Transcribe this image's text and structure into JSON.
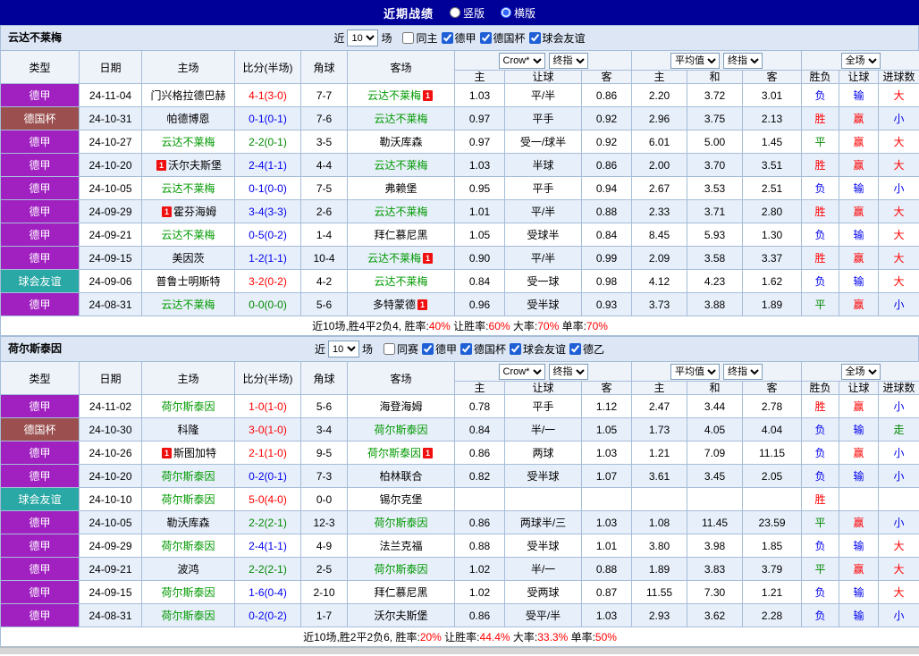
{
  "topbar": {
    "title": "近期战绩",
    "options": [
      {
        "label": "竖版",
        "selected": false
      },
      {
        "label": "横版",
        "selected": true
      }
    ]
  },
  "table_headers": {
    "main": [
      "类型",
      "日期",
      "主场",
      "比分(半场)",
      "角球",
      "客场"
    ],
    "odds_selects": [
      "Crow*",
      "终指"
    ],
    "avg_selects": [
      "平均值",
      "终指"
    ],
    "full_selects": [
      "全场"
    ],
    "sub": [
      "主",
      "让球",
      "客",
      "主",
      "和",
      "客",
      "胜负",
      "让球",
      "进球数"
    ]
  },
  "palette": {
    "red": "#ff0000",
    "green": "#008800",
    "blue": "#0000ee",
    "team_green": "#009900",
    "black": "#000000",
    "topbar_bg": "#000099",
    "league_colors": {
      "德甲": "#a020c0",
      "德国杯": "#9b4f4f",
      "球会友谊": "#2aa8a5"
    }
  },
  "sections": [
    {
      "team": "云达不莱梅",
      "filter": {
        "prefix": "近",
        "count": "10",
        "suffix": "场",
        "checkboxes": [
          {
            "label": "同主",
            "checked": false
          },
          {
            "label": "德甲",
            "checked": true
          },
          {
            "label": "德国杯",
            "checked": true
          },
          {
            "label": "球会友谊",
            "checked": true
          }
        ]
      },
      "rows": [
        {
          "league": "德甲",
          "date": "24-11-04",
          "home": {
            "name": "门兴格拉德巴赫"
          },
          "score": {
            "text": "4-1(3-0)",
            "color": "red"
          },
          "corner": "7-7",
          "away": {
            "name": "云达不莱梅",
            "self": true,
            "badge_after": "1"
          },
          "odds": [
            "1.03",
            "平/半",
            "0.86"
          ],
          "avg": [
            "2.20",
            "3.72",
            "3.01"
          ],
          "result": [
            [
              "负",
              "blue"
            ],
            [
              "输",
              "blue"
            ],
            [
              "大",
              "red"
            ]
          ]
        },
        {
          "league": "德国杯",
          "date": "24-10-31",
          "home": {
            "name": "帕德博恩"
          },
          "score": {
            "text": "0-1(0-1)",
            "color": "blue"
          },
          "corner": "7-6",
          "away": {
            "name": "云达不莱梅",
            "self": true
          },
          "odds": [
            "0.97",
            "平手",
            "0.92"
          ],
          "avg": [
            "2.96",
            "3.75",
            "2.13"
          ],
          "result": [
            [
              "胜",
              "red"
            ],
            [
              "赢",
              "red"
            ],
            [
              "小",
              "blue"
            ]
          ]
        },
        {
          "league": "德甲",
          "date": "24-10-27",
          "home": {
            "name": "云达不莱梅",
            "self": true
          },
          "score": {
            "text": "2-2(0-1)",
            "color": "green"
          },
          "corner": "3-5",
          "away": {
            "name": "勒沃库森"
          },
          "odds": [
            "0.97",
            "受一/球半",
            "0.92"
          ],
          "avg": [
            "6.01",
            "5.00",
            "1.45"
          ],
          "result": [
            [
              "平",
              "green"
            ],
            [
              "赢",
              "red"
            ],
            [
              "大",
              "red"
            ]
          ]
        },
        {
          "league": "德甲",
          "date": "24-10-20",
          "home": {
            "name": "沃尔夫斯堡",
            "badge_before": "1"
          },
          "score": {
            "text": "2-4(1-1)",
            "color": "blue"
          },
          "corner": "4-4",
          "away": {
            "name": "云达不莱梅",
            "self": true
          },
          "odds": [
            "1.03",
            "半球",
            "0.86"
          ],
          "avg": [
            "2.00",
            "3.70",
            "3.51"
          ],
          "result": [
            [
              "胜",
              "red"
            ],
            [
              "赢",
              "red"
            ],
            [
              "大",
              "red"
            ]
          ]
        },
        {
          "league": "德甲",
          "date": "24-10-05",
          "home": {
            "name": "云达不莱梅",
            "self": true
          },
          "score": {
            "text": "0-1(0-0)",
            "color": "blue"
          },
          "corner": "7-5",
          "away": {
            "name": "弗赖堡"
          },
          "odds": [
            "0.95",
            "平手",
            "0.94"
          ],
          "avg": [
            "2.67",
            "3.53",
            "2.51"
          ],
          "result": [
            [
              "负",
              "blue"
            ],
            [
              "输",
              "blue"
            ],
            [
              "小",
              "blue"
            ]
          ]
        },
        {
          "league": "德甲",
          "date": "24-09-29",
          "home": {
            "name": "霍芬海姆",
            "badge_before": "1"
          },
          "score": {
            "text": "3-4(3-3)",
            "color": "blue"
          },
          "corner": "2-6",
          "away": {
            "name": "云达不莱梅",
            "self": true
          },
          "odds": [
            "1.01",
            "平/半",
            "0.88"
          ],
          "avg": [
            "2.33",
            "3.71",
            "2.80"
          ],
          "result": [
            [
              "胜",
              "red"
            ],
            [
              "赢",
              "red"
            ],
            [
              "大",
              "red"
            ]
          ]
        },
        {
          "league": "德甲",
          "date": "24-09-21",
          "home": {
            "name": "云达不莱梅",
            "self": true
          },
          "score": {
            "text": "0-5(0-2)",
            "color": "blue"
          },
          "corner": "1-4",
          "away": {
            "name": "拜仁慕尼黑"
          },
          "odds": [
            "1.05",
            "受球半",
            "0.84"
          ],
          "avg": [
            "8.45",
            "5.93",
            "1.30"
          ],
          "result": [
            [
              "负",
              "blue"
            ],
            [
              "输",
              "blue"
            ],
            [
              "大",
              "red"
            ]
          ]
        },
        {
          "league": "德甲",
          "date": "24-09-15",
          "home": {
            "name": "美因茨"
          },
          "score": {
            "text": "1-2(1-1)",
            "color": "blue"
          },
          "corner": "10-4",
          "away": {
            "name": "云达不莱梅",
            "self": true,
            "badge_after": "1"
          },
          "odds": [
            "0.90",
            "平/半",
            "0.99"
          ],
          "avg": [
            "2.09",
            "3.58",
            "3.37"
          ],
          "result": [
            [
              "胜",
              "red"
            ],
            [
              "赢",
              "red"
            ],
            [
              "大",
              "red"
            ]
          ]
        },
        {
          "league": "球会友谊",
          "date": "24-09-06",
          "home": {
            "name": "普鲁士明斯特"
          },
          "score": {
            "text": "3-2(0-2)",
            "color": "red"
          },
          "corner": "4-2",
          "away": {
            "name": "云达不莱梅",
            "self": true
          },
          "odds": [
            "0.84",
            "受一球",
            "0.98"
          ],
          "avg": [
            "4.12",
            "4.23",
            "1.62"
          ],
          "result": [
            [
              "负",
              "blue"
            ],
            [
              "输",
              "blue"
            ],
            [
              "大",
              "red"
            ]
          ]
        },
        {
          "league": "德甲",
          "date": "24-08-31",
          "home": {
            "name": "云达不莱梅",
            "self": true
          },
          "score": {
            "text": "0-0(0-0)",
            "color": "green"
          },
          "corner": "5-6",
          "away": {
            "name": "多特蒙德",
            "badge_after": "1"
          },
          "odds": [
            "0.96",
            "受半球",
            "0.93"
          ],
          "avg": [
            "3.73",
            "3.88",
            "1.89"
          ],
          "result": [
            [
              "平",
              "green"
            ],
            [
              "赢",
              "red"
            ],
            [
              "小",
              "blue"
            ]
          ]
        }
      ],
      "summary": [
        {
          "t": "近10场,胜4平2负4, 胜率:",
          "red": false
        },
        {
          "t": "40%",
          "red": true
        },
        {
          "t": " 让胜率:",
          "red": false
        },
        {
          "t": "60%",
          "red": true
        },
        {
          "t": " 大率:",
          "red": false
        },
        {
          "t": "70%",
          "red": true
        },
        {
          "t": " 单率:",
          "red": false
        },
        {
          "t": "70%",
          "red": true
        }
      ]
    },
    {
      "team": "荷尔斯泰因",
      "filter": {
        "prefix": "近",
        "count": "10",
        "suffix": "场",
        "checkboxes": [
          {
            "label": "同赛",
            "checked": false
          },
          {
            "label": "德甲",
            "checked": true
          },
          {
            "label": "德国杯",
            "checked": true
          },
          {
            "label": "球会友谊",
            "checked": true
          },
          {
            "label": "德乙",
            "checked": true
          }
        ]
      },
      "rows": [
        {
          "league": "德甲",
          "date": "24-11-02",
          "home": {
            "name": "荷尔斯泰因",
            "self": true
          },
          "score": {
            "text": "1-0(1-0)",
            "color": "red"
          },
          "corner": "5-6",
          "away": {
            "name": "海登海姆"
          },
          "odds": [
            "0.78",
            "平手",
            "1.12"
          ],
          "avg": [
            "2.47",
            "3.44",
            "2.78"
          ],
          "result": [
            [
              "胜",
              "red"
            ],
            [
              "赢",
              "red"
            ],
            [
              "小",
              "blue"
            ]
          ]
        },
        {
          "league": "德国杯",
          "date": "24-10-30",
          "home": {
            "name": "科隆"
          },
          "score": {
            "text": "3-0(1-0)",
            "color": "red"
          },
          "corner": "3-4",
          "away": {
            "name": "荷尔斯泰因",
            "self": true
          },
          "odds": [
            "0.84",
            "半/一",
            "1.05"
          ],
          "avg": [
            "1.73",
            "4.05",
            "4.04"
          ],
          "result": [
            [
              "负",
              "blue"
            ],
            [
              "输",
              "blue"
            ],
            [
              "走",
              "green"
            ]
          ]
        },
        {
          "league": "德甲",
          "date": "24-10-26",
          "home": {
            "name": "斯图加特",
            "badge_before": "1"
          },
          "score": {
            "text": "2-1(1-0)",
            "color": "red"
          },
          "corner": "9-5",
          "away": {
            "name": "荷尔斯泰因",
            "self": true,
            "badge_after": "1"
          },
          "odds": [
            "0.86",
            "两球",
            "1.03"
          ],
          "avg": [
            "1.21",
            "7.09",
            "11.15"
          ],
          "result": [
            [
              "负",
              "blue"
            ],
            [
              "赢",
              "red"
            ],
            [
              "小",
              "blue"
            ]
          ]
        },
        {
          "league": "德甲",
          "date": "24-10-20",
          "home": {
            "name": "荷尔斯泰因",
            "self": true
          },
          "score": {
            "text": "0-2(0-1)",
            "color": "blue"
          },
          "corner": "7-3",
          "away": {
            "name": "柏林联合"
          },
          "odds": [
            "0.82",
            "受半球",
            "1.07"
          ],
          "avg": [
            "3.61",
            "3.45",
            "2.05"
          ],
          "result": [
            [
              "负",
              "blue"
            ],
            [
              "输",
              "blue"
            ],
            [
              "小",
              "blue"
            ]
          ]
        },
        {
          "league": "球会友谊",
          "date": "24-10-10",
          "home": {
            "name": "荷尔斯泰因",
            "self": true
          },
          "score": {
            "text": "5-0(4-0)",
            "color": "red"
          },
          "corner": "0-0",
          "away": {
            "name": "锡尔克堡"
          },
          "odds": [
            "",
            "",
            ""
          ],
          "avg": [
            "",
            "",
            ""
          ],
          "result": [
            [
              "胜",
              "red"
            ],
            [
              "",
              ""
            ],
            [
              "",
              ""
            ]
          ]
        },
        {
          "league": "德甲",
          "date": "24-10-05",
          "home": {
            "name": "勒沃库森"
          },
          "score": {
            "text": "2-2(2-1)",
            "color": "green"
          },
          "corner": "12-3",
          "away": {
            "name": "荷尔斯泰因",
            "self": true
          },
          "odds": [
            "0.86",
            "两球半/三",
            "1.03"
          ],
          "avg": [
            "1.08",
            "11.45",
            "23.59"
          ],
          "result": [
            [
              "平",
              "green"
            ],
            [
              "赢",
              "red"
            ],
            [
              "小",
              "blue"
            ]
          ]
        },
        {
          "league": "德甲",
          "date": "24-09-29",
          "home": {
            "name": "荷尔斯泰因",
            "self": true
          },
          "score": {
            "text": "2-4(1-1)",
            "color": "blue"
          },
          "corner": "4-9",
          "away": {
            "name": "法兰克福"
          },
          "odds": [
            "0.88",
            "受半球",
            "1.01"
          ],
          "avg": [
            "3.80",
            "3.98",
            "1.85"
          ],
          "result": [
            [
              "负",
              "blue"
            ],
            [
              "输",
              "blue"
            ],
            [
              "大",
              "red"
            ]
          ]
        },
        {
          "league": "德甲",
          "date": "24-09-21",
          "home": {
            "name": "波鸿"
          },
          "score": {
            "text": "2-2(2-1)",
            "color": "green"
          },
          "corner": "2-5",
          "away": {
            "name": "荷尔斯泰因",
            "self": true
          },
          "odds": [
            "1.02",
            "半/一",
            "0.88"
          ],
          "avg": [
            "1.89",
            "3.83",
            "3.79"
          ],
          "result": [
            [
              "平",
              "green"
            ],
            [
              "赢",
              "red"
            ],
            [
              "大",
              "red"
            ]
          ]
        },
        {
          "league": "德甲",
          "date": "24-09-15",
          "home": {
            "name": "荷尔斯泰因",
            "self": true
          },
          "score": {
            "text": "1-6(0-4)",
            "color": "blue"
          },
          "corner": "2-10",
          "away": {
            "name": "拜仁慕尼黑"
          },
          "odds": [
            "1.02",
            "受两球",
            "0.87"
          ],
          "avg": [
            "11.55",
            "7.30",
            "1.21"
          ],
          "result": [
            [
              "负",
              "blue"
            ],
            [
              "输",
              "blue"
            ],
            [
              "大",
              "red"
            ]
          ]
        },
        {
          "league": "德甲",
          "date": "24-08-31",
          "home": {
            "name": "荷尔斯泰因",
            "self": true
          },
          "score": {
            "text": "0-2(0-2)",
            "color": "blue"
          },
          "corner": "1-7",
          "away": {
            "name": "沃尔夫斯堡"
          },
          "odds": [
            "0.86",
            "受平/半",
            "1.03"
          ],
          "avg": [
            "2.93",
            "3.62",
            "2.28"
          ],
          "result": [
            [
              "负",
              "blue"
            ],
            [
              "输",
              "blue"
            ],
            [
              "小",
              "blue"
            ]
          ]
        }
      ],
      "summary": [
        {
          "t": "近10场,胜2平2负6, 胜率:",
          "red": false
        },
        {
          "t": "20%",
          "red": true
        },
        {
          "t": " 让胜率:",
          "red": false
        },
        {
          "t": "44.4%",
          "red": true
        },
        {
          "t": " 大率:",
          "red": false
        },
        {
          "t": "33.3%",
          "red": true
        },
        {
          "t": " 单率:",
          "red": false
        },
        {
          "t": "50%",
          "red": true
        }
      ]
    }
  ]
}
